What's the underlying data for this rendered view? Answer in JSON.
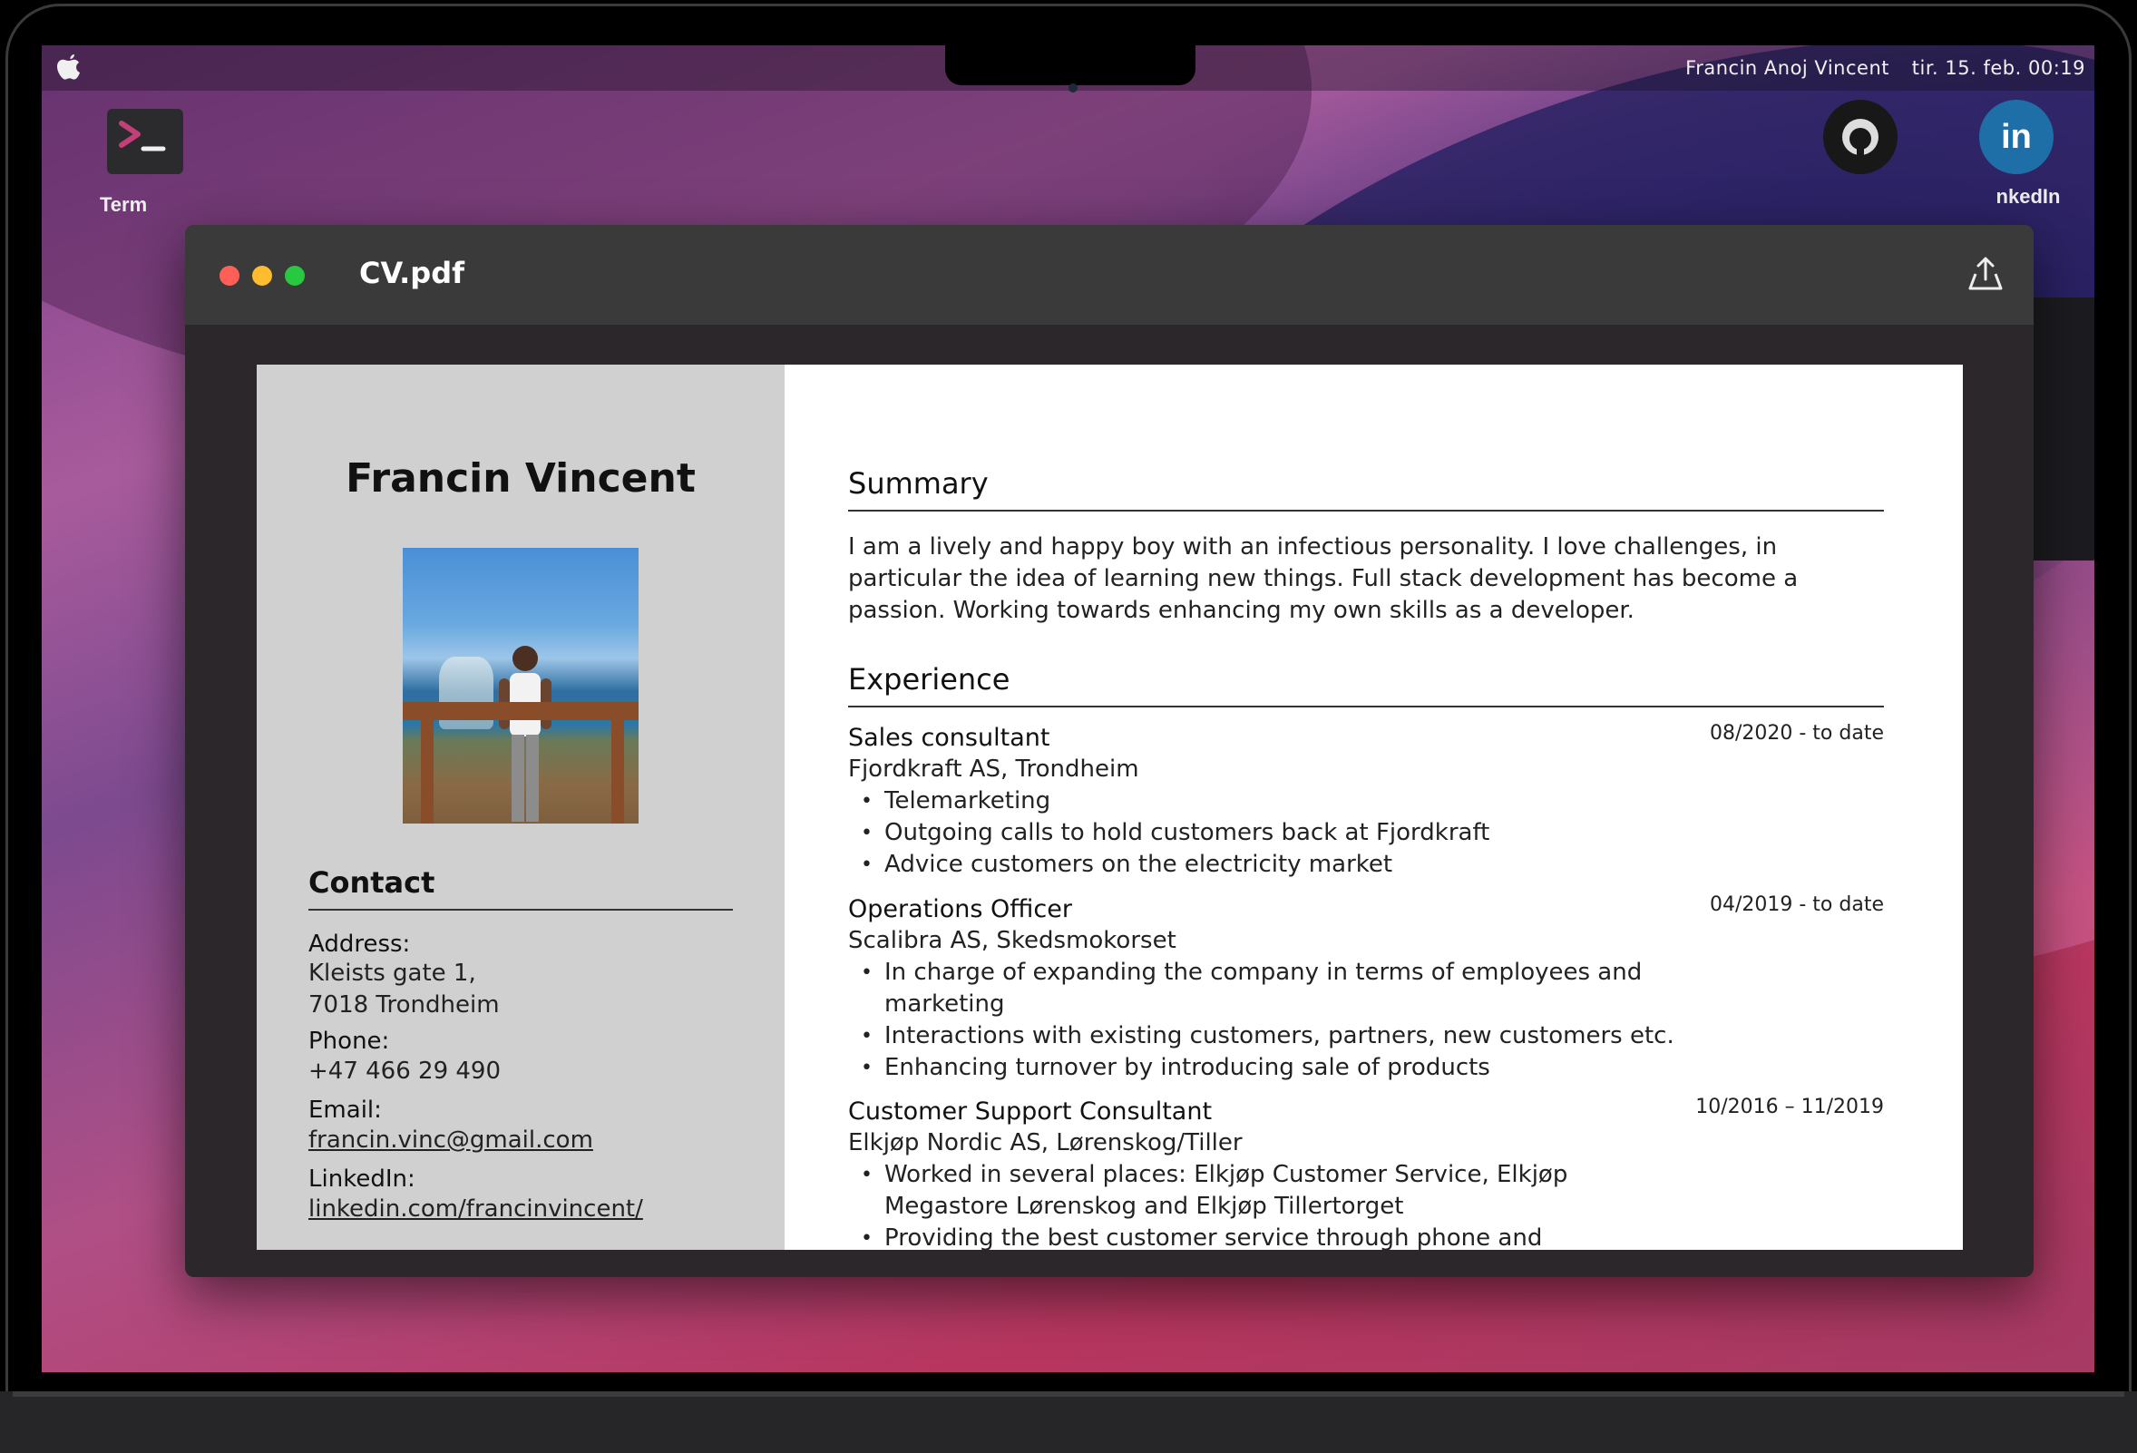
{
  "menubar": {
    "user_name": "Francin Anoj Vincent",
    "clock": "tir. 15. feb. 00:19"
  },
  "desktop": {
    "terminal_label": "Term",
    "linkedin_label": "nkedIn",
    "linkedin_glyph": "in"
  },
  "window": {
    "title": "CV.pdf"
  },
  "cv": {
    "name": "Francin Vincent",
    "contact": {
      "heading": "Contact",
      "address_label": "Address:",
      "address_line1": "Kleists gate 1,",
      "address_line2": "7018 Trondheim",
      "phone_label": "Phone:",
      "phone": "+47 466 29 490",
      "email_label": "Email:",
      "email": "francin.vinc@gmail.com",
      "linkedin_label": "LinkedIn:",
      "linkedin": "linkedin.com/francinvincent/"
    },
    "summary": {
      "heading": "Summary",
      "text": "I am a lively and happy boy with an infectious personality. I love challenges, in particular the idea of learning new things. Full stack development has become a passion. Working towards enhancing my own skills as a developer."
    },
    "experience": {
      "heading": "Experience",
      "jobs": [
        {
          "title": "Sales consultant",
          "company": "Fjordkraft AS, Trondheim",
          "date": "08/2020 - to date",
          "bullets": [
            "Telemarketing",
            "Outgoing calls to hold customers back at Fjordkraft",
            "Advice customers on the electricity market"
          ]
        },
        {
          "title": "Operations Officer",
          "company": "Scalibra AS, Skedsmokorset",
          "date": "04/2019 - to date",
          "bullets": [
            "In charge of expanding the company in terms of employees and marketing",
            "Interactions with existing customers, partners, new customers etc.",
            "Enhancing turnover by introducing sale of products"
          ]
        },
        {
          "title": "Customer Support Consultant",
          "company": "Elkjøp Nordic AS, Lørenskog/Tiller",
          "date": "10/2016 – 11/2019",
          "bullets": [
            "Worked in several places: Elkjøp Customer Service, Elkjøp Megastore Lørenskog and Elkjøp Tillertorget",
            "Providing the best customer service through phone and interactions in"
          ]
        }
      ]
    }
  },
  "icons": {
    "apple": "apple-icon",
    "terminal": "terminal-icon",
    "github": "github-icon",
    "linkedin": "linkedin-icon",
    "share": "share-icon"
  },
  "colors": {
    "traffic_close": "#ff5f57",
    "traffic_min": "#febc2e",
    "traffic_max": "#28c840",
    "linkedin_blue": "#1e6fa8",
    "sidebar_gray": "#d1d0d1"
  }
}
